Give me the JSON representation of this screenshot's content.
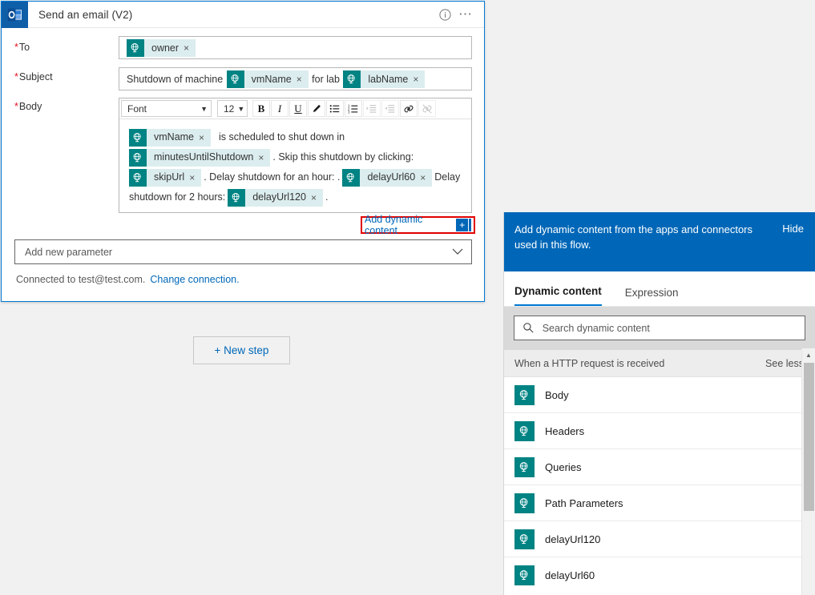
{
  "card": {
    "title": "Send an email (V2)",
    "app_icon": "outlook-icon",
    "info_icon": "info-icon",
    "more_icon": "ellipsis-icon",
    "fields": {
      "to": {
        "label": "To",
        "required_marker": "*",
        "tokens": [
          {
            "label": "owner",
            "icon": "http-request-token-icon",
            "remove": "×"
          }
        ]
      },
      "subject": {
        "label": "Subject",
        "required_marker": "*",
        "parts": [
          {
            "type": "text",
            "value": "Shutdown of machine"
          },
          {
            "type": "token",
            "value": "vmName",
            "icon": "http-request-token-icon",
            "remove": "×"
          },
          {
            "type": "text",
            "value": "for lab"
          },
          {
            "type": "token",
            "value": "labName",
            "icon": "http-request-token-icon",
            "remove": "×"
          }
        ]
      },
      "body": {
        "label": "Body",
        "required_marker": "*",
        "toolbar": {
          "font_family": "Font",
          "font_size": "12",
          "bold": "B",
          "italic": "I",
          "underline": "U",
          "highlight_icon": "highlighter-icon",
          "bulleted_list_icon": "bulleted-list-icon",
          "numbered_list_icon": "numbered-list-icon",
          "indent_icon": "indent-icon",
          "outdent_icon": "outdent-icon",
          "link_icon": "link-icon",
          "unlink_icon": "unlink-icon"
        },
        "content": [
          {
            "type": "token",
            "value": "vmName",
            "icon": "http-request-token-icon",
            "remove": "×"
          },
          {
            "type": "text",
            "value": "is scheduled to shut down in"
          },
          {
            "type": "token",
            "value": "minutesUntilShutdown",
            "icon": "http-request-token-icon",
            "remove": "×"
          },
          {
            "type": "text",
            "value": ". Skip this shutdown by clicking:"
          },
          {
            "type": "token",
            "value": "skipUrl",
            "icon": "http-request-token-icon",
            "remove": "×"
          },
          {
            "type": "text",
            "value": ". Delay shutdown for an hour: ."
          },
          {
            "type": "token",
            "value": "delayUrl60",
            "icon": "http-request-token-icon",
            "remove": "×"
          },
          {
            "type": "text",
            "value": "Delay shutdown for 2 hours:"
          },
          {
            "type": "token",
            "value": "delayUrl120",
            "icon": "http-request-token-icon",
            "remove": "×"
          },
          {
            "type": "text",
            "value": "."
          }
        ]
      }
    },
    "add_dynamic_content": {
      "label": "Add dynamic content",
      "plus": "+",
      "highlight_color": "#e00000"
    },
    "add_new_parameter": {
      "label": "Add new parameter",
      "chevron_icon": "chevron-down-icon"
    },
    "connection": {
      "text": "Connected to test@test.com.",
      "link": "Change connection."
    }
  },
  "canvas": {
    "new_step_button": "+ New step"
  },
  "panel": {
    "banner": {
      "text": "Add dynamic content from the apps and connectors used in this flow.",
      "hide_label": "Hide",
      "background": "#0067b8"
    },
    "tabs": [
      {
        "label": "Dynamic content",
        "active": true
      },
      {
        "label": "Expression",
        "active": false
      }
    ],
    "search": {
      "placeholder": "Search dynamic content",
      "value": "",
      "icon": "search-icon"
    },
    "group": {
      "name": "When a HTTP request is received",
      "toggle_label": "See less"
    },
    "items": [
      {
        "label": "Body",
        "icon": "http-request-token-icon"
      },
      {
        "label": "Headers",
        "icon": "http-request-token-icon"
      },
      {
        "label": "Queries",
        "icon": "http-request-token-icon"
      },
      {
        "label": "Path Parameters",
        "icon": "http-request-token-icon"
      },
      {
        "label": "delayUrl120",
        "icon": "http-request-token-icon"
      },
      {
        "label": "delayUrl60",
        "icon": "http-request-token-icon"
      }
    ],
    "scrollbar": {
      "up_arrow": "▲"
    }
  },
  "colors": {
    "accent_blue": "#0067b8",
    "card_border": "#0078d4",
    "token_teal": "#008383",
    "token_fill": "#dcedef",
    "required_red": "#e81123",
    "highlight_red": "#e00000"
  }
}
